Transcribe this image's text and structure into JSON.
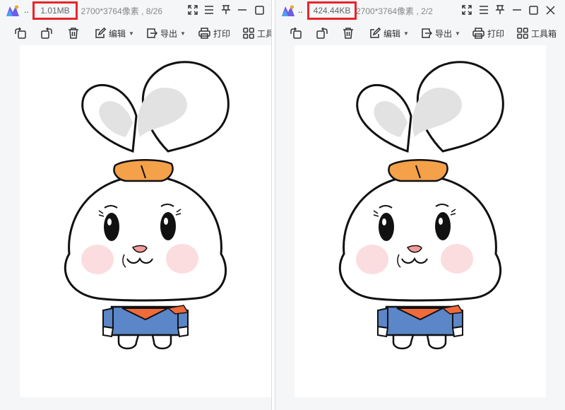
{
  "left_window": {
    "dots": "..",
    "file_size": "1.01MB",
    "dims_text": ", 2700*3764像素 , 8/26",
    "toolbar": {
      "edit_label": "编辑",
      "export_label": "导出",
      "print_label": "打印",
      "tools_label": "工具"
    }
  },
  "right_window": {
    "dots": "..",
    "file_size": "424.44KB",
    "dims_text": "2700*3764像素 , 2/2",
    "toolbar": {
      "edit_label": "编辑",
      "export_label": "导出",
      "print_label": "打印",
      "tools_label": "工具箱"
    }
  },
  "colors": {
    "highlight_box": "#e8242a",
    "ear_inner": "#e2e2e2",
    "bow": "#f4a14a",
    "cheek": "#fbdde0",
    "nose": "#f59a9a",
    "shirt": "#5b86c8",
    "scarf": "#f06a3a"
  },
  "icons": [
    "app-logo-icon",
    "fullscreen-icon",
    "menu-icon",
    "pin-icon",
    "minimize-icon",
    "maximize-icon",
    "close-icon",
    "rotate-left-icon",
    "rotate-right-icon",
    "delete-icon",
    "edit-icon",
    "export-icon",
    "print-icon",
    "toolbox-icon"
  ]
}
